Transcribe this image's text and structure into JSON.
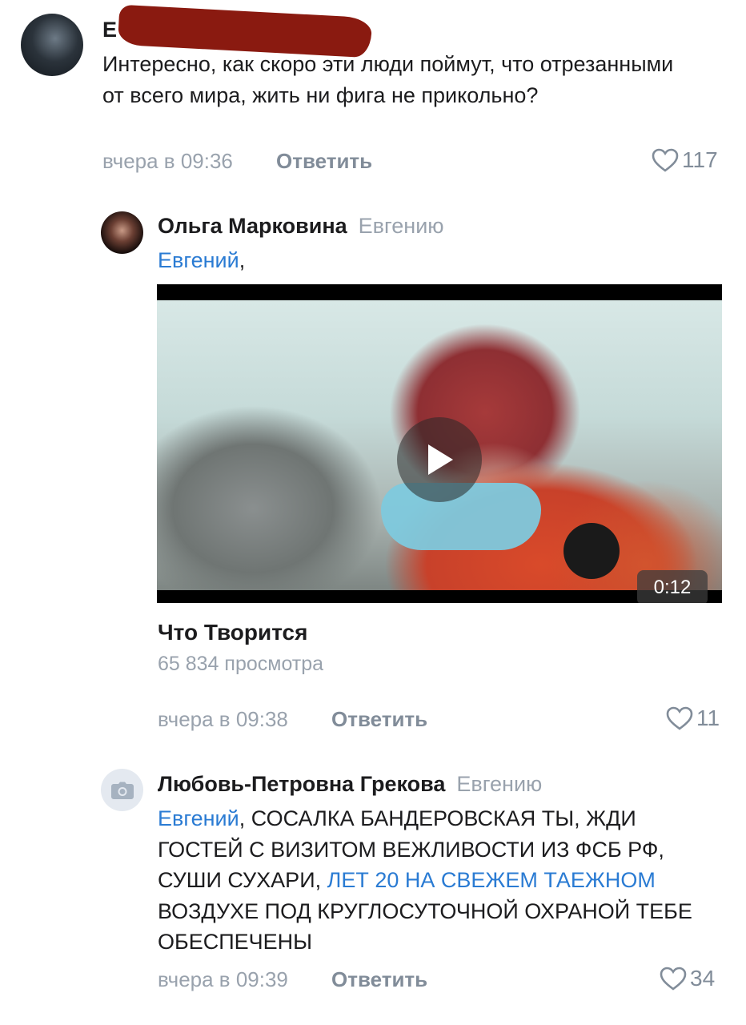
{
  "comment1": {
    "author_name_visible": "Е",
    "text": "Интересно, как скоро эти люди поймут, что отрезанными от всего мира, жить ни фига не прикольно?",
    "time": "вчера в 09:36",
    "reply_label": "Ответить",
    "likes": "117",
    "like_icon": "heart-outline-icon"
  },
  "comment2": {
    "author": "Ольга Марковина",
    "reply_to": "Евгению",
    "mention": "Евгений",
    "after_mention": ",",
    "video": {
      "duration": "0:12",
      "title": "Что Творится",
      "views": "65 834 просмотра",
      "play_icon": "play-icon"
    },
    "time": "вчера в 09:38",
    "reply_label": "Ответить",
    "likes": "11",
    "like_icon": "heart-outline-icon"
  },
  "comment3": {
    "author": "Любовь-Петровна Грекова",
    "reply_to": "Евгению",
    "mention": "Евгений",
    "text_part1": ", СОСАЛКА БАНДЕРОВСКАЯ ТЫ, ЖДИ ГОСТЕЙ С ВИЗИТОМ ВЕЖЛИВОСТИ ИЗ ФСБ РФ, СУШИ СУХАРИ, ",
    "link_text": "ЛЕТ 20 НА СВЕЖЕМ ТАЕЖНОМ",
    "text_part2": " ВОЗДУХЕ ПОД КРУГЛОСУТОЧНОЙ ОХРАНОЙ ТЕБЕ ОБЕСПЕЧЕНЫ",
    "avatar_icon": "camera-icon",
    "time": "вчера в 09:39",
    "reply_label": "Ответить",
    "likes": "34",
    "like_icon": "heart-outline-icon"
  },
  "colors": {
    "link": "#2a7bd3",
    "meta": "#99a2ad",
    "redaction": "#8a1a10"
  }
}
